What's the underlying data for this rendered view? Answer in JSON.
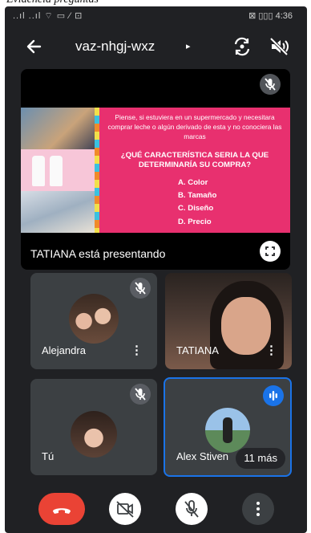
{
  "caption": {
    "text": "Evidencia preguntas"
  },
  "status_bar": {
    "signal_text": "..ıl ..ıl ⌔ ▭ ⁄ ⊡",
    "right_text": "⊠ ▯▯▯ 4:36"
  },
  "top_bar": {
    "back_icon": "arrow-back-icon",
    "meeting_code": "vaz-nhgj-wxz",
    "meeting_code_arrow": "▸",
    "switch_camera_icon": "switch-camera-icon",
    "audio_output_icon": "speaker-muted-icon"
  },
  "presentation": {
    "slide_intro": "Piense, si estuviera en un supermercado y necesitara comprar leche o algún derivado de esta y no conociera las marcas",
    "slide_question": "¿QUÉ CARACTERÍSTICA SERIA LA QUE DETERMINARÍA SU COMPRA?",
    "options": [
      "A. Color",
      "B. Tamaño",
      "C. Diseño",
      "D. Precio"
    ],
    "presenter_label": "TATIANA está presentando",
    "fullscreen_icon": "fullscreen-icon",
    "accent_color": "#e8306f"
  },
  "participants": [
    {
      "name": "Alejandra",
      "menu": "⋮",
      "muted": true
    },
    {
      "name": "TATIANA",
      "menu": "⋮",
      "muted": false
    },
    {
      "name": "Tú",
      "muted": true
    },
    {
      "name": "Alex Stiven",
      "speaking": true,
      "more_chip": "11 más"
    }
  ],
  "controls": {
    "hangup_icon": "end-call-icon",
    "camera_icon": "camera-off-icon",
    "mic_icon": "mic-off-icon",
    "menu_label": "⋮"
  },
  "colors": {
    "background": "#202124",
    "tile": "#3c4043",
    "active_border": "#1a73e8",
    "hangup": "#ea4335"
  }
}
